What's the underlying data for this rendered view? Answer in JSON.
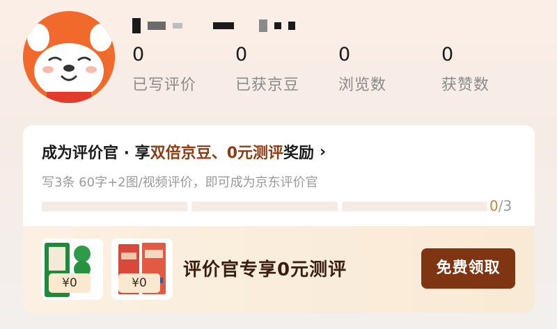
{
  "profile": {
    "avatar_icon": "mascot-avatar-icon"
  },
  "stats": [
    {
      "value": "0",
      "label": "已写评价"
    },
    {
      "value": "0",
      "label": "已获京豆"
    },
    {
      "value": "0",
      "label": "浏览数"
    },
    {
      "value": "0",
      "label": "获赞数"
    }
  ],
  "promo": {
    "title_prefix": "成为评价官 · 享",
    "title_highlight_1": "双倍京豆",
    "title_sep": "、",
    "title_highlight_2": "0元测评",
    "title_suffix": "奖励",
    "arrow": "›",
    "subtitle": "写3条 60字+2图/视频评价，即可成为京东评价官",
    "progress_current": "0",
    "progress_total": "/3",
    "progress_value": 0
  },
  "offer": {
    "thumb_1_price": "¥0",
    "thumb_2_price": "¥0",
    "text": "评价官专享0元测评",
    "button_label": "免费领取"
  },
  "colors": {
    "accent": "#8f3b14",
    "button": "#7f3412",
    "avatar_bg": "#f26a2b"
  }
}
